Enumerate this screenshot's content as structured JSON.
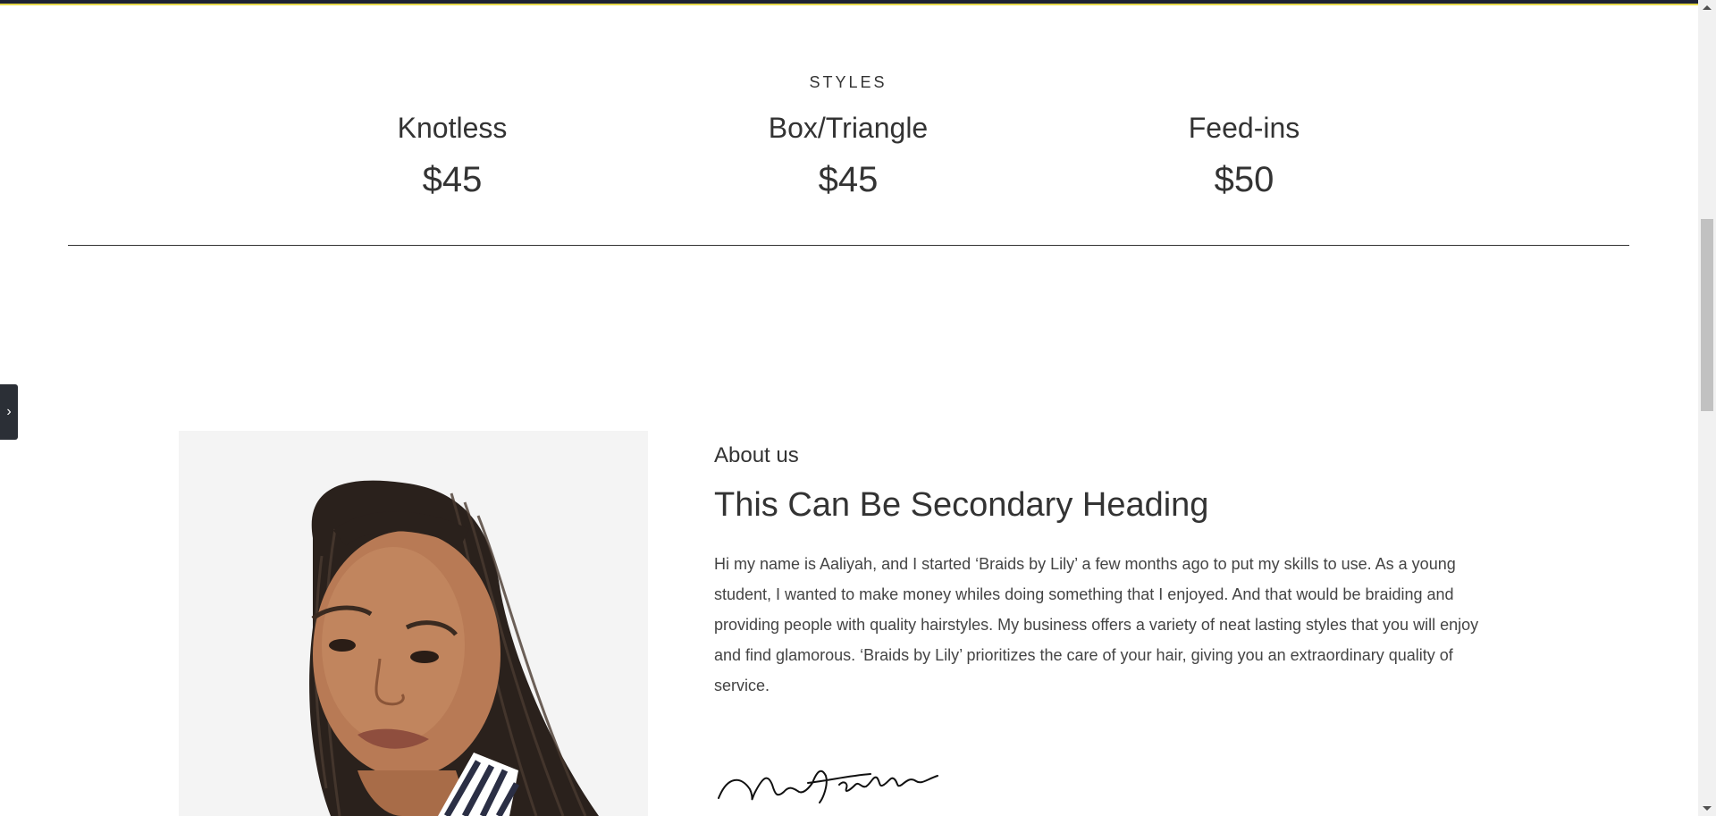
{
  "colors": {
    "header_bar": "#1e2233",
    "header_accent": "#e6d84a",
    "text": "#333333",
    "photo_bg": "#f4f4f4"
  },
  "styles_section": {
    "label": "STYLES",
    "items": [
      {
        "name": "Knotless",
        "price": "$45"
      },
      {
        "name": "Box/Triangle",
        "price": "$45"
      },
      {
        "name": "Feed-ins",
        "price": "$50"
      }
    ]
  },
  "side_toggle": {
    "icon": "chevron-right-icon",
    "glyph": "›"
  },
  "about": {
    "label": "About us",
    "heading": "This Can Be Secondary Heading",
    "body": "Hi my name is Aaliyah, and I started ‘Braids by Lily’ a few months ago to put my skills to use. As a young student, I wanted to make money whiles doing something that I enjoyed. And that would be braiding and providing people with quality hairstyles. My business offers a variety of neat lasting styles that you will enjoy and find glamorous. ‘Braids by Lily’ prioritizes the care of your hair, giving you an extraordinary quality of service.",
    "signature": "Mia Hoelchin"
  }
}
